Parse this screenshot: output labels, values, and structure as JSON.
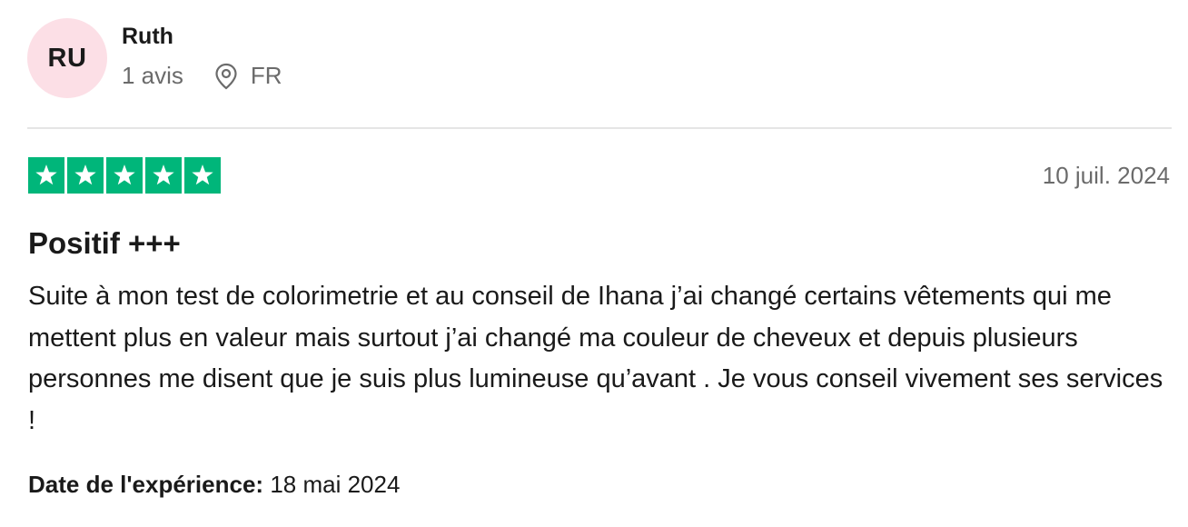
{
  "reviewer": {
    "initials": "RU",
    "name": "Ruth",
    "review_count": "1 avis",
    "country": "FR",
    "avatar_color": "#fcdfe6"
  },
  "review": {
    "rating": 5,
    "rating_max": 5,
    "star_color": "#00b67a",
    "date": "10 juil. 2024",
    "title": "Positif +++",
    "body": "Suite à mon test de colorimetrie et au conseil de Ihana j’ai changé certains vêtements qui me mettent plus en valeur mais surtout j’ai changé ma couleur de cheveux et depuis plusieurs personnes me disent que je suis plus lumineuse qu’avant . Je vous conseil vivement ses services !",
    "experience_label": "Date de l'expérience:",
    "experience_date": "18 mai 2024"
  },
  "icons": {
    "location": "location-pin-icon",
    "star": "star-icon"
  }
}
